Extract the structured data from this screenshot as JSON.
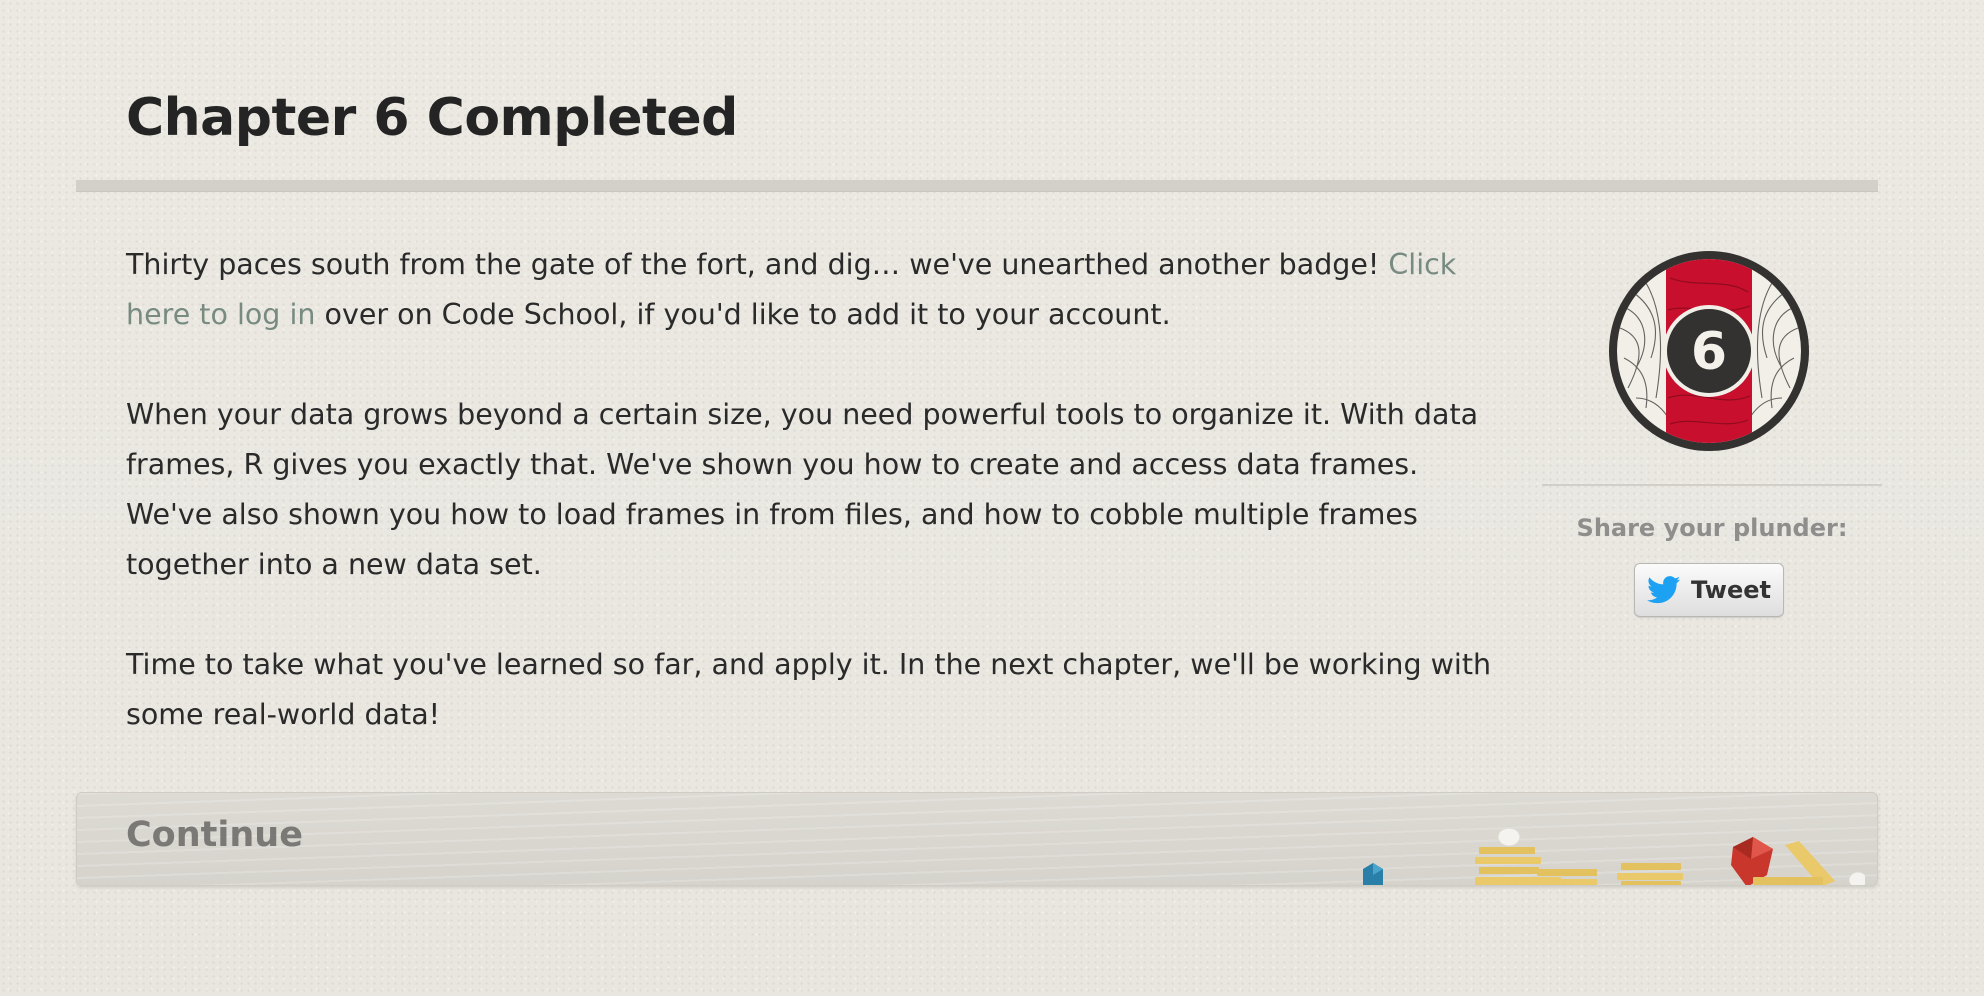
{
  "page": {
    "title": "Chapter 6 Completed"
  },
  "content": {
    "paragraph1_text": "Thirty paces south from the gate of the fort, and dig… we've unearthed another badge! ",
    "paragraph1_link": "Click here to log in",
    "paragraph1_tail": " over on Code School, if you'd like to add it to your account.",
    "paragraph2": "When your data grows beyond a certain size, you need powerful tools to organize it. With data frames, R gives you exactly that. We've shown you how to create and access data frames. We've also shown you how to load frames in from files, and how to cobble multiple frames together into a new data set.",
    "paragraph3": "Time to take what you've learned so far, and apply it. In the next chapter, we'll be working with some real-world data!"
  },
  "badge": {
    "number": "6",
    "colors": {
      "ring": "#333230",
      "stripe": "#c8102e"
    }
  },
  "share": {
    "label": "Share your plunder:",
    "tweet_label": "Tweet",
    "icon": "twitter-bird-icon",
    "icon_color": "#1da1f2"
  },
  "continue": {
    "label": "Continue"
  }
}
